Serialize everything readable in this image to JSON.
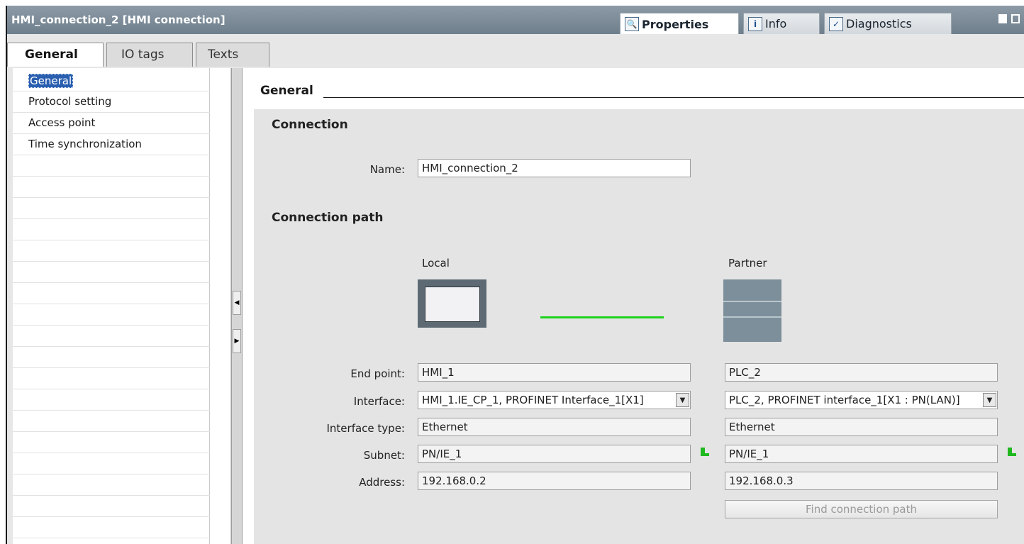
{
  "titlebar": {
    "title": "HMI_connection_2 [HMI connection]",
    "tabs": [
      {
        "label": "Properties",
        "icon": "properties-icon",
        "active": true
      },
      {
        "label": "Info",
        "icon": "info-icon",
        "active": false
      },
      {
        "label": "Diagnostics",
        "icon": "diagnostics-icon",
        "active": false
      }
    ]
  },
  "subtabs": [
    "General",
    "IO tags",
    "Texts"
  ],
  "nav": {
    "items": [
      "General",
      "Protocol setting",
      "Access point",
      "Time synchronization"
    ],
    "selected": "General"
  },
  "content": {
    "header": "General",
    "connection": {
      "title": "Connection",
      "name_label": "Name:",
      "name_value": "HMI_connection_2"
    },
    "path": {
      "title": "Connection path",
      "local_label": "Local",
      "partner_label": "Partner",
      "labels": {
        "end_point": "End point:",
        "interface": "Interface:",
        "interface_type": "Interface type:",
        "subnet": "Subnet:",
        "address": "Address:"
      },
      "local": {
        "end_point": "HMI_1",
        "interface": "HMI_1.IE_CP_1, PROFINET Interface_1[X1]",
        "interface_type": "Ethernet",
        "subnet": "PN/IE_1",
        "address": "192.168.0.2"
      },
      "partner": {
        "end_point": "PLC_2",
        "interface": "PLC_2, PROFINET interface_1[X1 : PN(LAN)]",
        "interface_type": "Ethernet",
        "subnet": "PN/IE_1",
        "address": "192.168.0.3"
      },
      "find_button": "Find connection path"
    }
  },
  "colors": {
    "titlebar": "#7a8996",
    "selection": "#2a5fb0",
    "link": "#1ed21e"
  }
}
